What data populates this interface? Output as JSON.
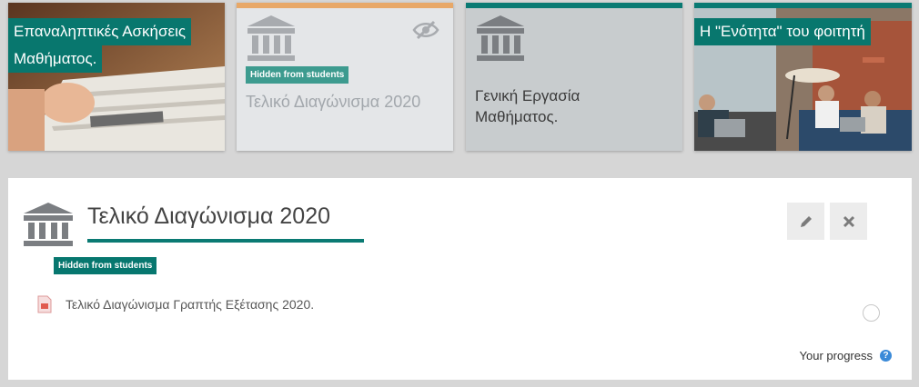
{
  "tiles": [
    {
      "label_lines": [
        "Επαναληπτικές Ασκήσεις",
        "Μαθήματος."
      ]
    },
    {
      "badge": "Hidden from students",
      "title": "Τελικό Διαγώνισμα 2020"
    },
    {
      "title_lines": [
        "Γενική Εργασία",
        "Μαθήματος."
      ]
    },
    {
      "label": "Η \"Ενότητα\" του φοιτητή"
    }
  ],
  "section": {
    "title": "Τελικό Διαγώνισμα 2020",
    "badge": "Hidden from students",
    "resource_name": "Τελικό Διαγώνισμα Γραπτής Εξέτασης 2020.",
    "progress_label": "Your progress",
    "help_glyph": "?"
  },
  "icons": [
    "institution-icon",
    "eye-slash-icon",
    "pencil-icon",
    "close-icon",
    "pdf-icon",
    "completion-checkbox-icon",
    "help-icon"
  ],
  "colors": {
    "accent": "#0a7a73",
    "hidden_bar": "#e8a868",
    "badge": "#07776f"
  }
}
